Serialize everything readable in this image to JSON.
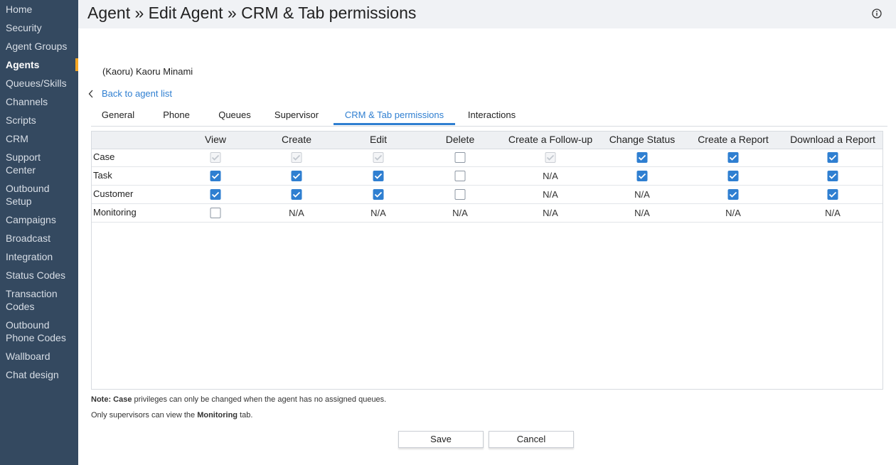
{
  "sidebar": {
    "items": [
      {
        "label": "Home",
        "lines": [
          "Home"
        ]
      },
      {
        "label": "Security",
        "lines": [
          "Security"
        ]
      },
      {
        "label": "Agent Groups",
        "lines": [
          "Agent Groups"
        ]
      },
      {
        "label": "Agents",
        "lines": [
          "Agents"
        ],
        "active": true
      },
      {
        "label": "Queues/Skills",
        "lines": [
          "Queues/Skills"
        ]
      },
      {
        "label": "Channels",
        "lines": [
          "Channels"
        ]
      },
      {
        "label": "Scripts",
        "lines": [
          "Scripts"
        ]
      },
      {
        "label": "CRM",
        "lines": [
          "CRM"
        ]
      },
      {
        "label": "Support Center",
        "lines": [
          "Support",
          "Center"
        ]
      },
      {
        "label": "Outbound Setup",
        "lines": [
          "Outbound",
          "Setup"
        ]
      },
      {
        "label": "Campaigns",
        "lines": [
          "Campaigns"
        ]
      },
      {
        "label": "Broadcast",
        "lines": [
          "Broadcast"
        ]
      },
      {
        "label": "Integration",
        "lines": [
          "Integration"
        ]
      },
      {
        "label": "Status Codes",
        "lines": [
          "Status Codes"
        ]
      },
      {
        "label": "Transaction Codes",
        "lines": [
          "Transaction",
          "Codes"
        ]
      },
      {
        "label": "Outbound Phone Codes",
        "lines": [
          "Outbound",
          "Phone Codes"
        ]
      },
      {
        "label": "Wallboard",
        "lines": [
          "Wallboard"
        ]
      },
      {
        "label": "Chat design",
        "lines": [
          "Chat design"
        ]
      }
    ]
  },
  "header": {
    "title": "Agent » Edit Agent » CRM & Tab permissions",
    "info_icon": "info-circle-icon"
  },
  "agent": {
    "name": "(Kaoru) Kaoru Minami"
  },
  "back_link": {
    "label": "Back to agent list",
    "icon": "chevron-left-icon"
  },
  "tabs": [
    {
      "label": "General"
    },
    {
      "label": "Phone"
    },
    {
      "label": "Queues"
    },
    {
      "label": "Supervisor"
    },
    {
      "label": "CRM & Tab permissions",
      "active": true
    },
    {
      "label": "Interactions"
    }
  ],
  "permissions": {
    "columns": [
      "View",
      "Create",
      "Edit",
      "Delete",
      "Create a Follow-up",
      "Change Status",
      "Create a Report",
      "Download a Report"
    ],
    "rows": [
      {
        "label": "Case",
        "cells": [
          "disabled-checked",
          "disabled-checked",
          "disabled-checked",
          "unchecked",
          "disabled-checked",
          "checked",
          "checked",
          "checked"
        ]
      },
      {
        "label": "Task",
        "cells": [
          "checked",
          "checked",
          "checked",
          "unchecked",
          "N/A",
          "checked",
          "checked",
          "checked"
        ]
      },
      {
        "label": "Customer",
        "cells": [
          "checked",
          "checked",
          "checked",
          "unchecked",
          "N/A",
          "N/A",
          "checked",
          "checked"
        ]
      },
      {
        "label": "Monitoring",
        "cells": [
          "unchecked",
          "N/A",
          "N/A",
          "N/A",
          "N/A",
          "N/A",
          "N/A",
          "N/A"
        ]
      }
    ]
  },
  "notes": {
    "line1_prefix": "Note:",
    "line1_strong": "Case",
    "line1_rest": "privileges can only be changed when the agent has no assigned queues.",
    "line2_prefix": "Only supervisors can view the",
    "line2_strong": "Monitoring",
    "line2_suffix": "tab."
  },
  "buttons": {
    "save": "Save",
    "cancel": "Cancel"
  },
  "colors": {
    "sidebar_bg": "#344960",
    "accent": "#2f7fd1",
    "active_marker": "#f5a623"
  }
}
